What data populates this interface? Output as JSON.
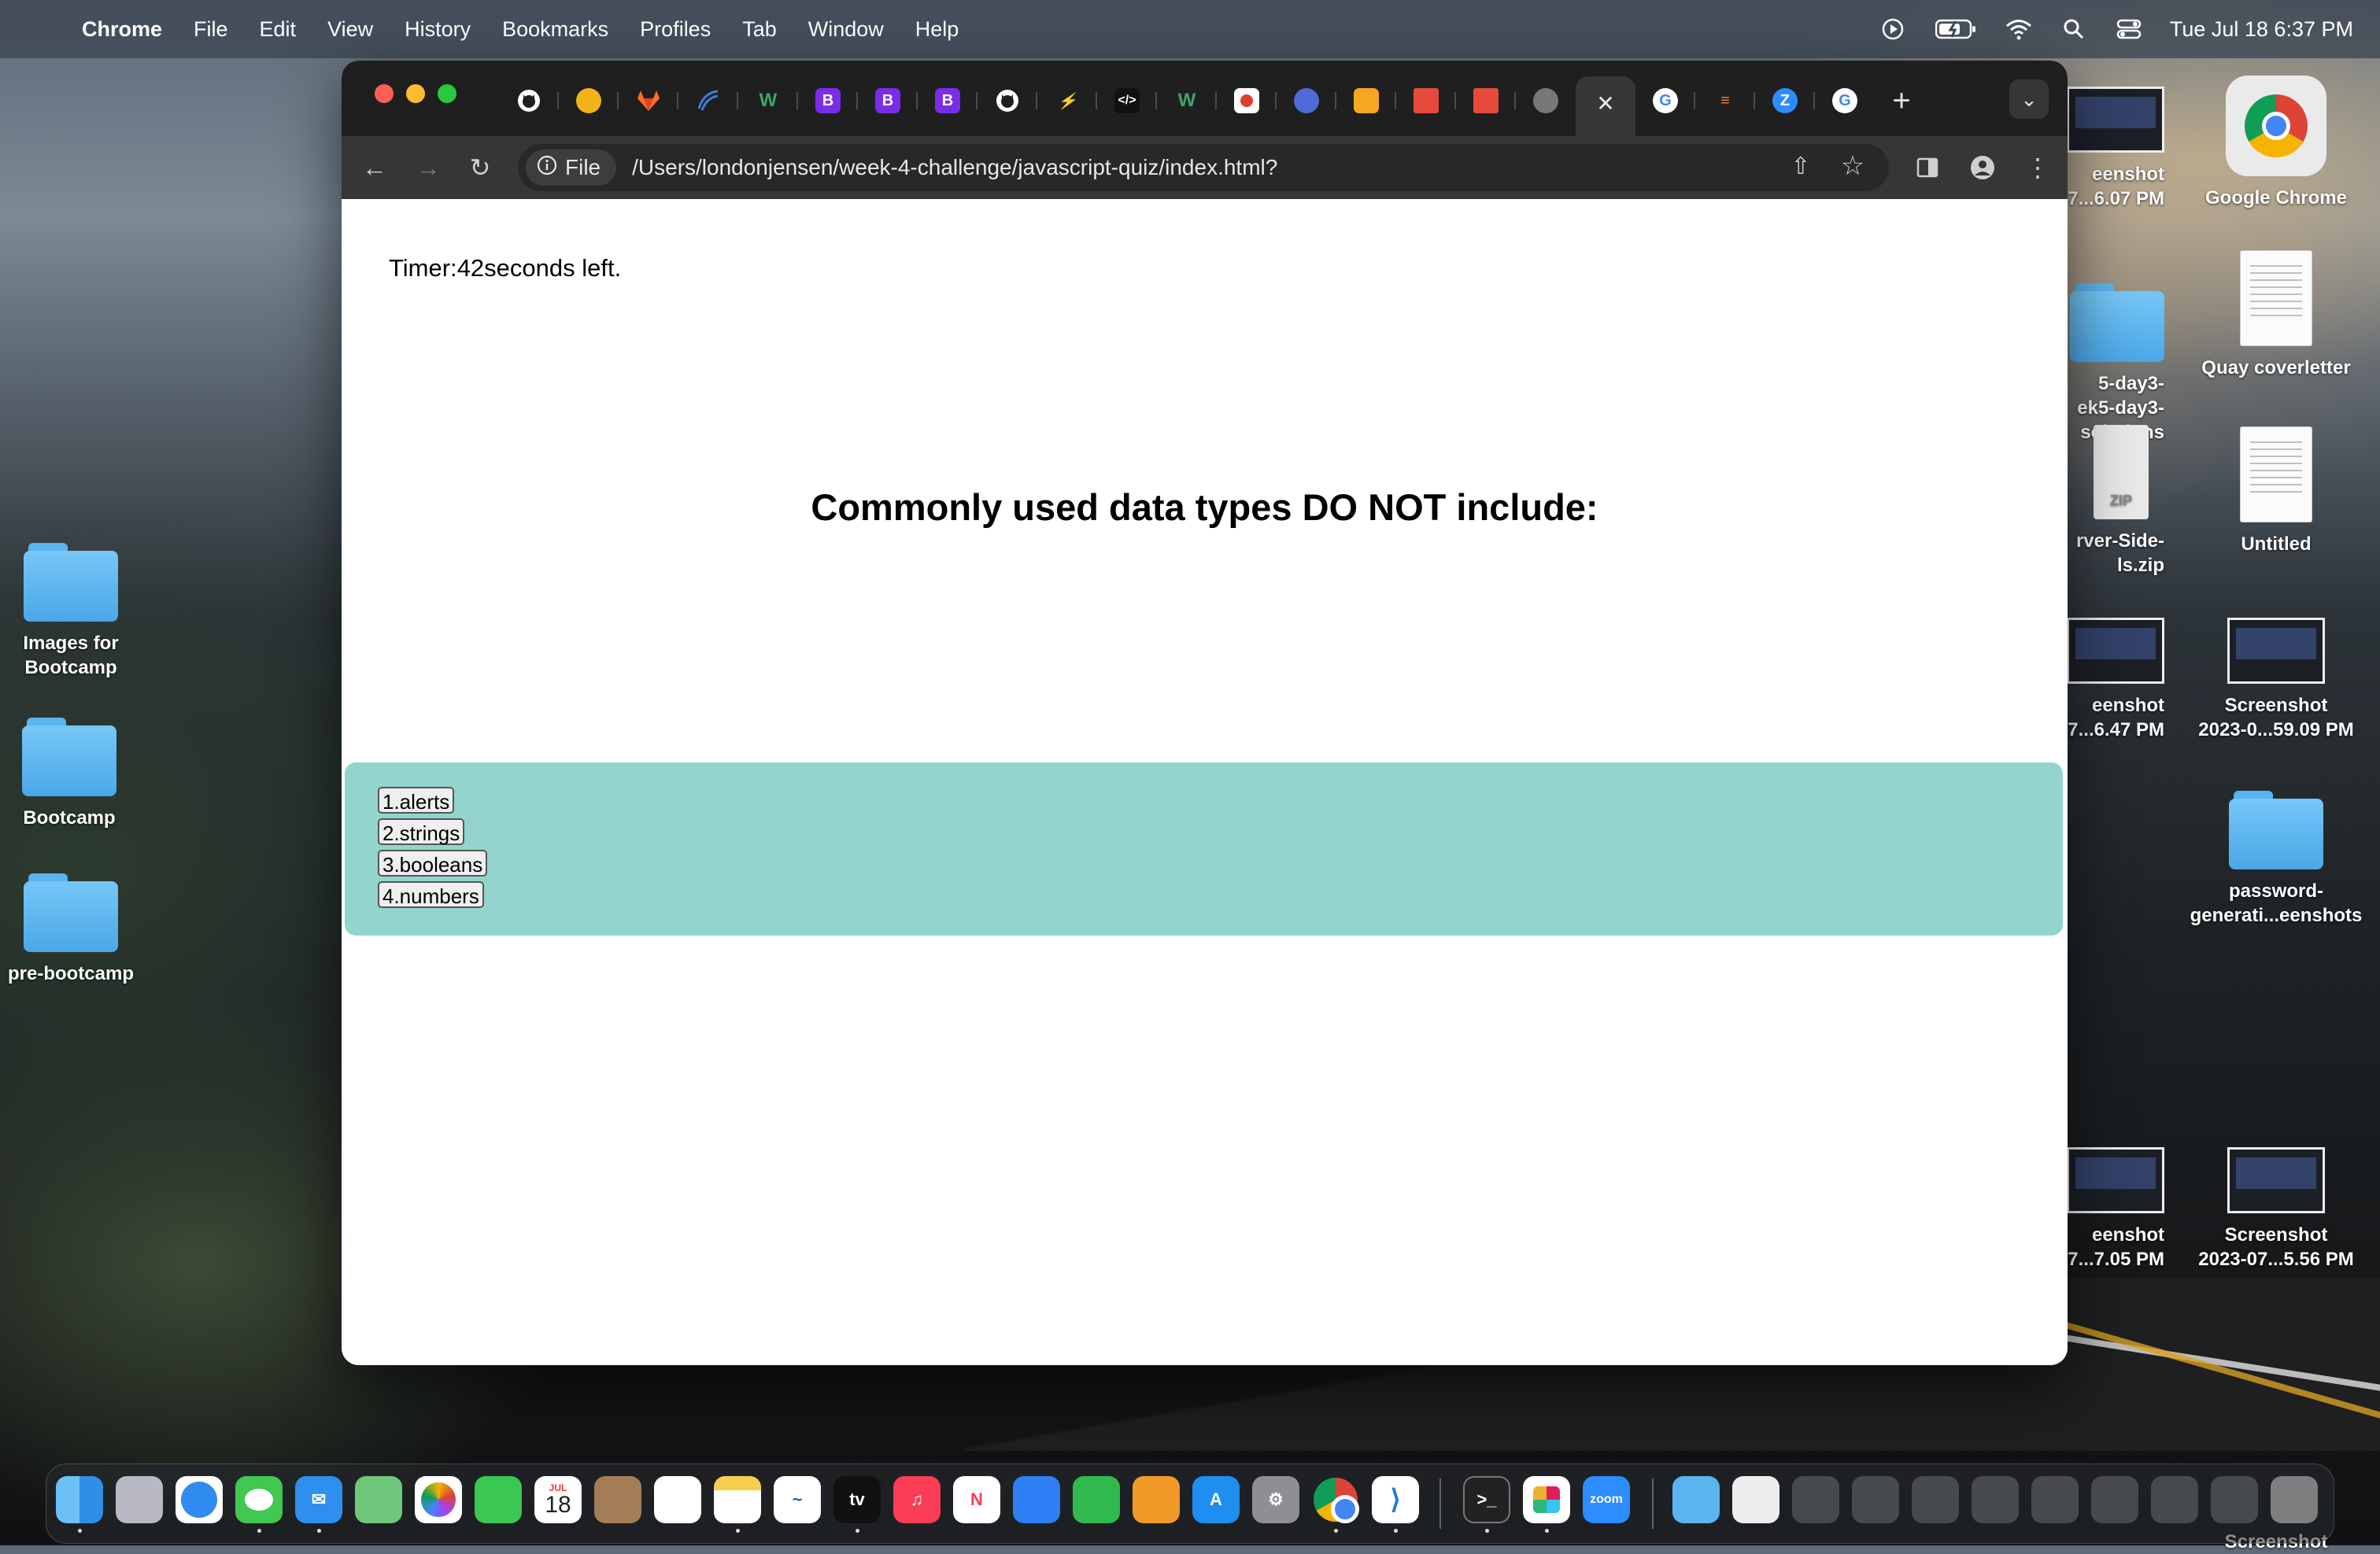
{
  "menubar": {
    "app": "Chrome",
    "items": [
      "File",
      "Edit",
      "View",
      "History",
      "Bookmarks",
      "Profiles",
      "Tab",
      "Window",
      "Help"
    ],
    "datetime": "Tue Jul 18  6:37 PM"
  },
  "desktop_left": [
    {
      "label_line1": "Images for",
      "label_line2": "Bootcamp"
    },
    {
      "label_line1": "Bootcamp",
      "label_line2": ""
    },
    {
      "label_line1": "pre-bootcamp",
      "label_line2": ""
    }
  ],
  "desktop_right": {
    "chrome": "Google Chrome",
    "quay": "Quay coverletter",
    "untitled": "Untitled",
    "screenshot1_l1": "Screenshot",
    "screenshot1_l2": "2023-0...59.09 PM",
    "password_l1": "password-",
    "password_l2": "generati...eenshots",
    "screenshot2_l1": "Screenshot",
    "screenshot2_l2": "2023-07...5.56 PM"
  },
  "desktop_partial": {
    "a_l1": "eenshot",
    "a_l2": "7...6.07 PM",
    "b_l1": "5-day3-",
    "b_l2": "ek5-day3-",
    "b_l3": "solutions",
    "zip_l1": "rver-Side-",
    "zip_l2": "ls.zip",
    "zip_badge": "ZIP",
    "c_l1": "eenshot",
    "c_l2": "7...6.47 PM",
    "d_l1": "eenshot",
    "d_l2": "7...7.05 PM",
    "bottom_cut": "Screenshot"
  },
  "browser": {
    "tab_icons": [
      "github-icon",
      "codecademy-icon",
      "gitlab-icon",
      "wave-icon",
      "w-icon",
      "bootstrap-icon",
      "bootstrap-icon",
      "bootstrap-icon",
      "github-icon",
      "stackblitz-icon",
      "code-icon",
      "w-icon",
      "red-circle-icon",
      "badge-icon",
      "shield-icon",
      "day-icon",
      "day-icon",
      "globe-icon",
      "close-icon",
      "google-icon",
      "stackoverflow-icon",
      "zoom-icon",
      "google-icon"
    ],
    "address_chip": "File",
    "url": "/Users/londonjensen/week-4-challenge/javascript-quiz/index.html?"
  },
  "quiz": {
    "timer_prefix": "Timer:",
    "timer_value": "42",
    "timer_suffix": "seconds left.",
    "question": "Commonly used data types DO NOT include:",
    "answers": [
      "1.alerts",
      "2.strings",
      "3.booleans",
      "4.numbers"
    ]
  },
  "dock": {
    "calendar_month": "JUL",
    "calendar_day": "18",
    "tv_label": "tv",
    "zoom_label": "zoom",
    "terminal_label": ">_"
  },
  "colors": {
    "answers_bg": "#93d5ce",
    "tabstrip_bg": "#1f1f1f",
    "toolbar_bg": "#363636"
  }
}
